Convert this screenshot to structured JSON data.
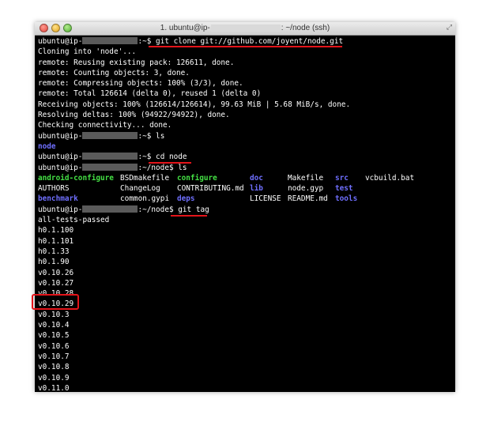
{
  "window": {
    "title_prefix": "1. ubuntu@ip-",
    "title_suffix": ": ~/node (ssh)"
  },
  "prompt": {
    "user": "ubuntu@ip-",
    "home": ":~$",
    "node_dir": ":~/node$"
  },
  "lines": {
    "cmd1": "git clone git://github.com/joyent/node.git",
    "o1": "Cloning into 'node'...",
    "o2": "remote: Reusing existing pack: 126611, done.",
    "o3": "remote: Counting objects: 3, done.",
    "o4": "remote: Compressing objects: 100% (3/3), done.",
    "o5": "remote: Total 126614 (delta 0), reused 1 (delta 0)",
    "o6": "Receiving objects: 100% (126614/126614), 99.63 MiB | 5.68 MiB/s, done.",
    "o7": "Resolving deltas: 100% (94922/94922), done.",
    "o8": "Checking connectivity... done.",
    "cmd2": "ls",
    "o9": "node",
    "cmd3": "cd node",
    "cmd4": "ls",
    "cmd5": "git tag"
  },
  "ls_listing": [
    [
      "android-configure",
      "BSDmakefile",
      "configure",
      "doc",
      "Makefile",
      "src",
      "vcbuild.bat"
    ],
    [
      "AUTHORS",
      "ChangeLog",
      "CONTRIBUTING.md",
      "lib",
      "node.gyp",
      "test",
      ""
    ],
    [
      "benchmark",
      "common.gypi",
      "deps",
      "LICENSE",
      "README.md",
      "tools",
      ""
    ]
  ],
  "tags": [
    "all-tests-passed",
    "h0.1.100",
    "h0.1.101",
    "h0.1.33",
    "h0.1.90",
    "v0.10.26",
    "v0.10.27",
    "v0.10.28",
    "v0.10.29",
    "v0.10.3",
    "v0.10.4",
    "v0.10.5",
    "v0.10.6",
    "v0.10.7",
    "v0.10.8",
    "v0.10.9",
    "v0.11.0"
  ],
  "colors": {
    "directory": "#6f6fff",
    "executable": "#44e044",
    "highlight": "#e4141a"
  }
}
